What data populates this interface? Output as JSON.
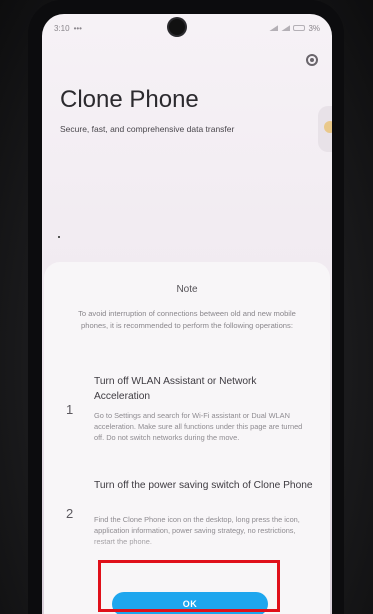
{
  "status_bar": {
    "time": "3:10",
    "left_icons": "•••",
    "battery": "3%"
  },
  "app": {
    "title": "Clone Phone",
    "subtitle": "Secure, fast, and comprehensive data transfer"
  },
  "dialog": {
    "title": "Note",
    "intro": "To avoid interruption of connections between old and new mobile phones, it is recommended to perform the following operations:",
    "steps": [
      {
        "number": "1",
        "title": "Turn off WLAN Assistant or Network Acceleration",
        "description": "Go to Settings and search for Wi-Fi assistant or Dual WLAN acceleration. Make sure all functions under this page are turned off. Do not switch networks during the move."
      },
      {
        "number": "2",
        "title": "Turn off the power saving switch of Clone Phone",
        "description": "Find the Clone Phone icon on the desktop, long press the icon, application information, power saving strategy, no restrictions, restart the phone."
      }
    ],
    "ok_label": "OK"
  },
  "colors": {
    "accent": "#1ea6ee",
    "highlight": "#e0101a"
  },
  "icons": [
    "settings-icon",
    "camera-cutout",
    "signal-icon",
    "battery-icon"
  ]
}
